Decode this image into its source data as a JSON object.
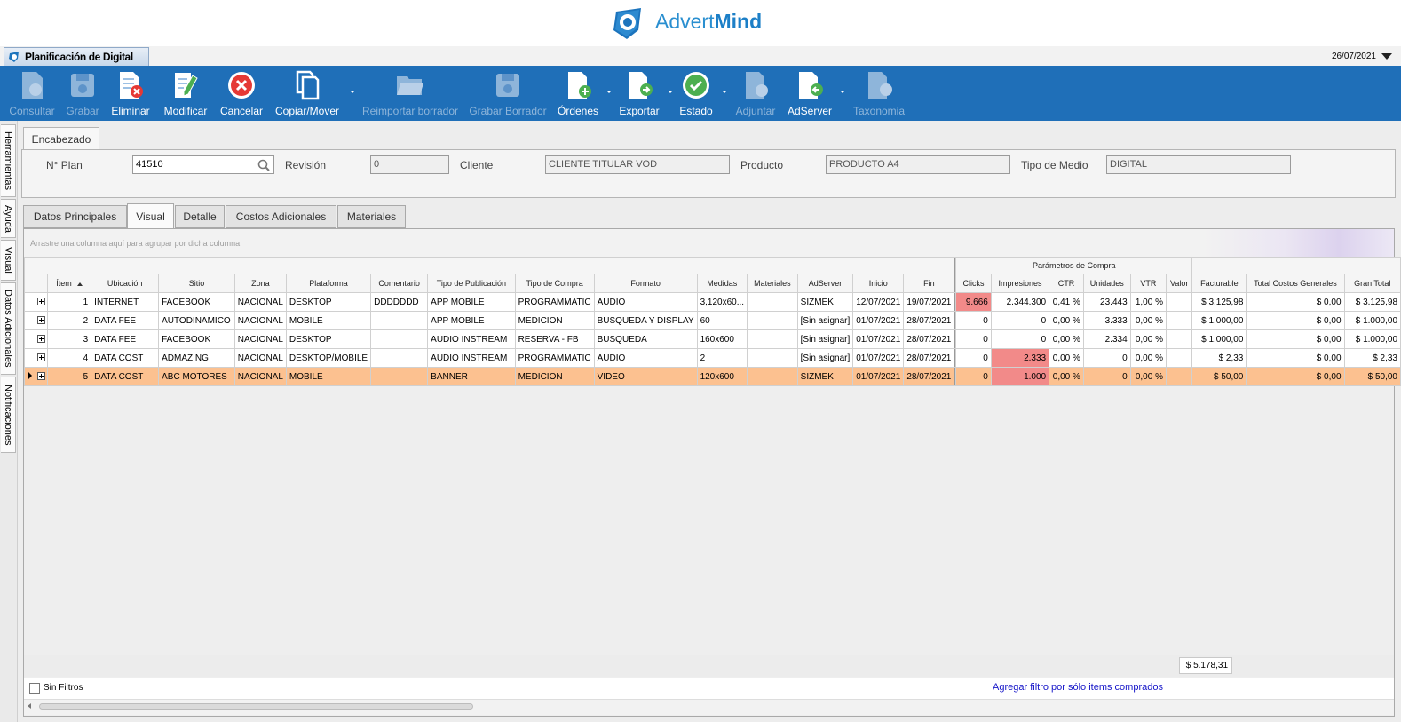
{
  "brand": {
    "name_light": "Advert",
    "name_bold": "Mind"
  },
  "app_tab": {
    "title": "Planificación de Digital"
  },
  "date": "26/07/2021",
  "toolbar": [
    {
      "label": "Consultar",
      "icon": "consult-icon",
      "enabled": false,
      "dropdown": false
    },
    {
      "label": "Grabar",
      "icon": "save-icon",
      "enabled": false,
      "dropdown": false
    },
    {
      "label": "Eliminar",
      "icon": "delete-icon",
      "enabled": true,
      "dropdown": false
    },
    {
      "label": "Modificar",
      "icon": "edit-icon",
      "enabled": true,
      "dropdown": false
    },
    {
      "label": "Cancelar",
      "icon": "cancel-icon",
      "enabled": true,
      "dropdown": false
    },
    {
      "label": "Copiar/Mover",
      "icon": "copy-icon",
      "enabled": true,
      "dropdown": true
    },
    {
      "label": "Reimportar borrador",
      "icon": "folder-open-icon",
      "enabled": false,
      "dropdown": false
    },
    {
      "label": "Grabar Borrador",
      "icon": "save-draft-icon",
      "enabled": false,
      "dropdown": false
    },
    {
      "label": "Órdenes",
      "icon": "orders-icon",
      "enabled": true,
      "dropdown": true
    },
    {
      "label": "Exportar",
      "icon": "export-icon",
      "enabled": true,
      "dropdown": true
    },
    {
      "label": "Estado",
      "icon": "status-icon",
      "enabled": true,
      "dropdown": true
    },
    {
      "label": "Adjuntar",
      "icon": "attach-icon",
      "enabled": false,
      "dropdown": false
    },
    {
      "label": "AdServer",
      "icon": "adserver-icon",
      "enabled": true,
      "dropdown": true
    },
    {
      "label": "Taxonomia",
      "icon": "taxonomy-icon",
      "enabled": false,
      "dropdown": false
    }
  ],
  "side_tabs": [
    "Herramientas",
    "Ayuda",
    "Visual",
    "Datos Adicionales",
    "Notificaciones"
  ],
  "header": {
    "tab": "Encabezado",
    "plan_label": "N° Plan",
    "plan_value": "41510",
    "revision_label": "Revisión",
    "revision_value": "0",
    "cliente_label": "Cliente",
    "cliente_value": "CLIENTE TITULAR VOD",
    "producto_label": "Producto",
    "producto_value": "PRODUCTO A4",
    "medio_label": "Tipo de Medio",
    "medio_value": "DIGITAL"
  },
  "tabs": [
    "Datos Principales",
    "Visual",
    "Detalle",
    "Costos Adicionales",
    "Materiales"
  ],
  "active_tab": "Visual",
  "grid": {
    "group_hint": "Arrastre una columna aquí para agrupar por dicha columna",
    "band_label": "Parámetros de Compra",
    "columns": [
      "Ítem",
      "Ubicación",
      "Sitio",
      "Zona",
      "Plataforma",
      "Comentario",
      "Tipo de Publicación",
      "Tipo de Compra",
      "Formato",
      "Medidas",
      "Materiales",
      "AdServer",
      "Inicio",
      "Fin",
      "Clicks",
      "Impresiones",
      "CTR",
      "Unidades",
      "VTR",
      "Valor",
      "Facturable",
      "Total Costos Generales",
      "Gran Total"
    ],
    "rows": [
      {
        "item": "1",
        "ubicacion": "INTERNET.",
        "sitio": "FACEBOOK",
        "zona": "NACIONAL",
        "plataforma": "DESKTOP",
        "comentario": "DDDDDDD",
        "tipo_pub": "APP MOBILE",
        "tipo_compra": "PROGRAMMATIC",
        "formato": "AUDIO",
        "medidas": "3,120x60...",
        "materiales": "",
        "adserver": "SIZMEK",
        "inicio": "12/07/2021",
        "fin": "19/07/2021",
        "clicks": "9.666",
        "impresiones": "2.344.300",
        "ctr": "0,41 %",
        "unidades": "23.443",
        "vtr": "1,00 %",
        "valor": "",
        "facturable": "$ 3.125,98",
        "costos": "$ 0,00",
        "gran_total": "$ 3.125,98",
        "clicks_alert": true,
        "impr_alert": false
      },
      {
        "item": "2",
        "ubicacion": "DATA FEE",
        "sitio": "AUTODINAMICO",
        "zona": "NACIONAL",
        "plataforma": "MOBILE",
        "comentario": "",
        "tipo_pub": "APP MOBILE",
        "tipo_compra": "MEDICION",
        "formato": "BUSQUEDA Y DISPLAY",
        "medidas": "60",
        "materiales": "",
        "adserver": "[Sin asignar]",
        "inicio": "01/07/2021",
        "fin": "28/07/2021",
        "clicks": "0",
        "impresiones": "0",
        "ctr": "0,00 %",
        "unidades": "3.333",
        "vtr": "0,00 %",
        "valor": "",
        "facturable": "$ 1.000,00",
        "costos": "$ 0,00",
        "gran_total": "$ 1.000,00",
        "clicks_alert": false,
        "impr_alert": false
      },
      {
        "item": "3",
        "ubicacion": "DATA FEE",
        "sitio": "FACEBOOK",
        "zona": "NACIONAL",
        "plataforma": "DESKTOP",
        "comentario": "",
        "tipo_pub": "AUDIO INSTREAM",
        "tipo_compra": "RESERVA - FB",
        "formato": "BUSQUEDA",
        "medidas": "160x600",
        "materiales": "",
        "adserver": "[Sin asignar]",
        "inicio": "01/07/2021",
        "fin": "28/07/2021",
        "clicks": "0",
        "impresiones": "0",
        "ctr": "0,00 %",
        "unidades": "2.334",
        "vtr": "0,00 %",
        "valor": "",
        "facturable": "$ 1.000,00",
        "costos": "$ 0,00",
        "gran_total": "$ 1.000,00",
        "clicks_alert": false,
        "impr_alert": false
      },
      {
        "item": "4",
        "ubicacion": "DATA COST",
        "sitio": "ADMAZING",
        "zona": "NACIONAL",
        "plataforma": "DESKTOP/MOBILE",
        "comentario": "",
        "tipo_pub": "AUDIO INSTREAM",
        "tipo_compra": "PROGRAMMATIC",
        "formato": "AUDIO",
        "medidas": "2",
        "materiales": "",
        "adserver": "[Sin asignar]",
        "inicio": "01/07/2021",
        "fin": "28/07/2021",
        "clicks": "0",
        "impresiones": "2.333",
        "ctr": "0,00 %",
        "unidades": "0",
        "vtr": "0,00 %",
        "valor": "",
        "facturable": "$ 2,33",
        "costos": "$ 0,00",
        "gran_total": "$ 2,33",
        "clicks_alert": false,
        "impr_alert": true
      },
      {
        "item": "5",
        "ubicacion": "DATA COST",
        "sitio": "ABC MOTORES",
        "zona": "NACIONAL",
        "plataforma": "MOBILE",
        "comentario": "",
        "tipo_pub": "BANNER",
        "tipo_compra": "MEDICION",
        "formato": "VIDEO",
        "medidas": "120x600",
        "materiales": "",
        "adserver": "SIZMEK",
        "inicio": "01/07/2021",
        "fin": "28/07/2021",
        "clicks": "0",
        "impresiones": "1.000",
        "ctr": "0,00 %",
        "unidades": "0",
        "vtr": "0,00 %",
        "valor": "",
        "facturable": "$ 50,00",
        "costos": "$ 0,00",
        "gran_total": "$ 50,00",
        "clicks_alert": false,
        "impr_alert": true
      }
    ],
    "selected_row": 4,
    "total_facturable": "$ 5.178,31"
  },
  "footer": {
    "no_filters_label": "Sin Filtros",
    "filter_link": "Agregar filtro por sólo items comprados"
  },
  "colors": {
    "toolbar_bg": "#1f6fb8",
    "selected_row": "#fcc190",
    "alert_cell": "#f28a89",
    "link": "#1515c8"
  }
}
